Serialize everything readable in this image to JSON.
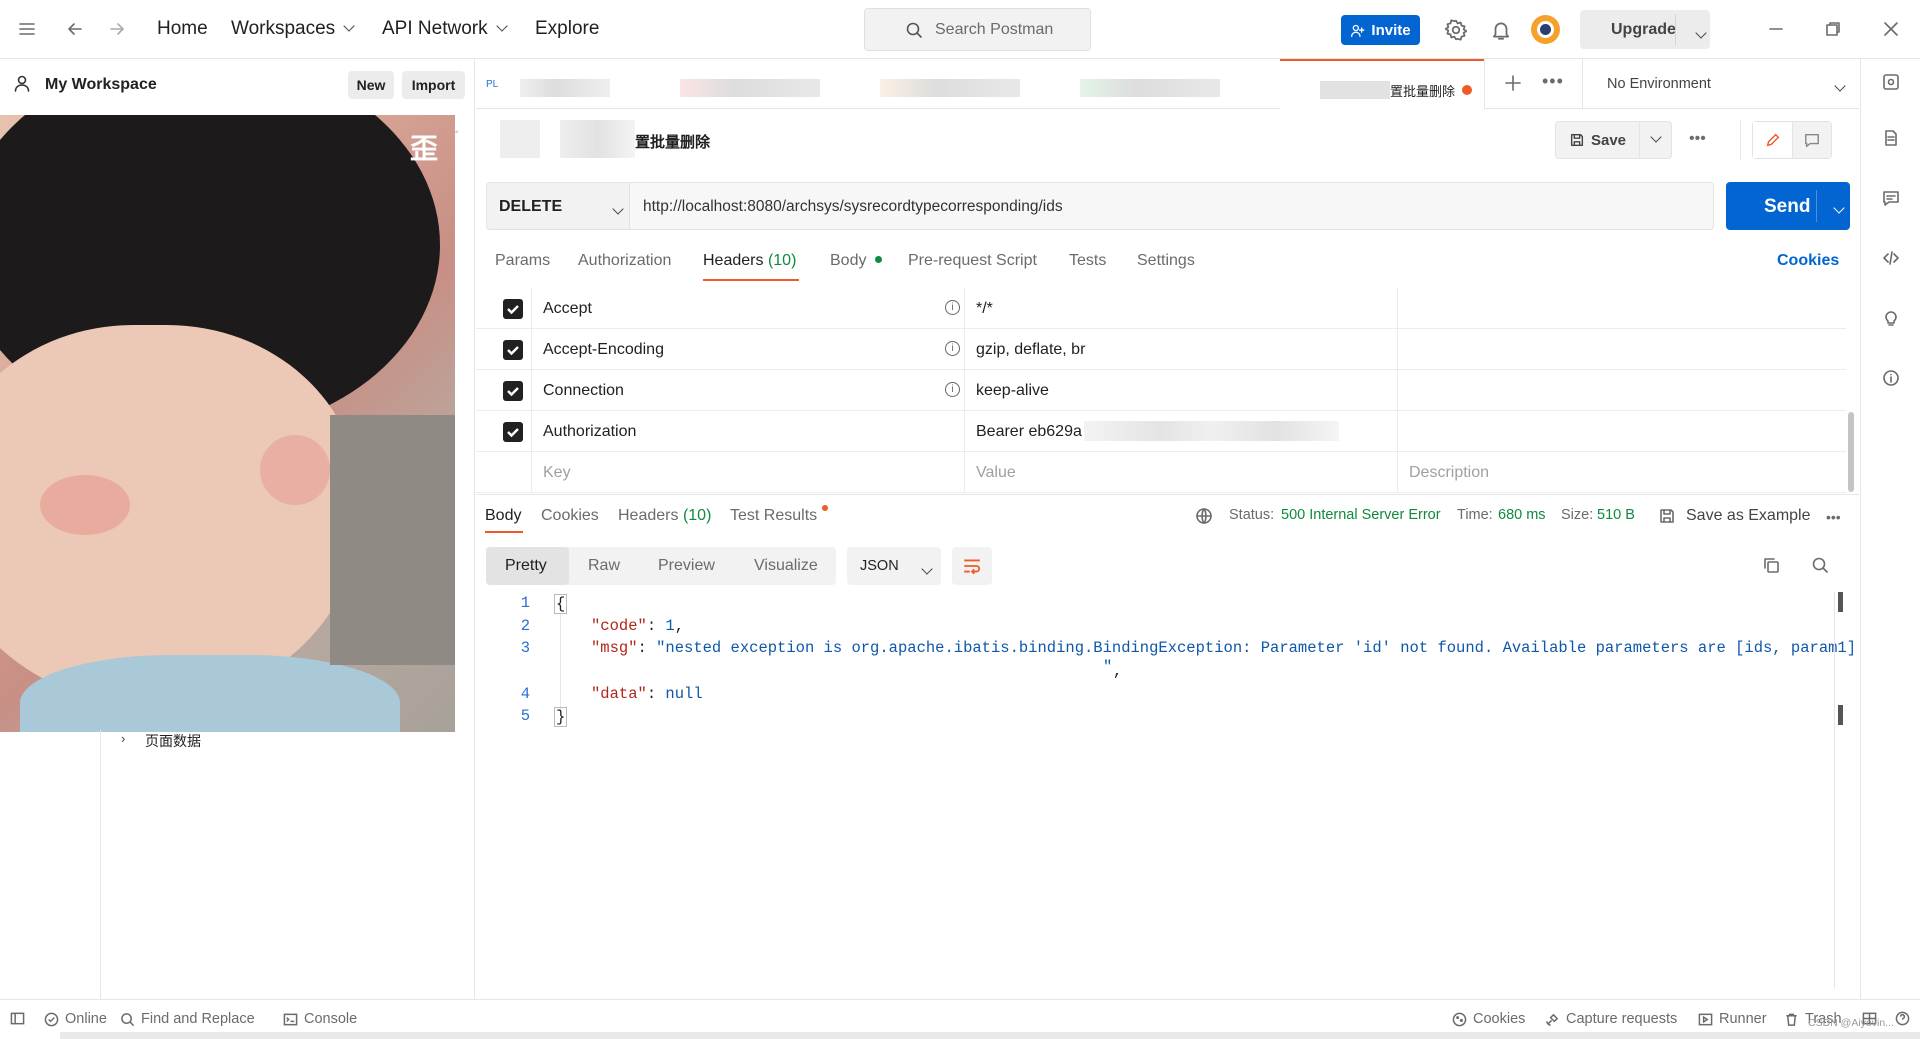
{
  "topbar": {
    "nav": [
      "Home",
      "Workspaces",
      "API Network",
      "Explore"
    ],
    "search_placeholder": "Search Postman",
    "invite": "Invite",
    "upgrade": "Upgrade"
  },
  "sidebar": {
    "workspace": "My Workspace",
    "new_label": "New",
    "import_label": "Import",
    "overlay_glyph": "歪",
    "tree_item": "页面数据"
  },
  "tabs": {
    "first_prefix": "PL",
    "active_tab_suffix": "置批量删除",
    "environment": "No Environment"
  },
  "request": {
    "name_suffix": "置批量删除",
    "save_label": "Save",
    "method": "DELETE",
    "url": "http://localhost:8080/archsys/sysrecordtypecorresponding/ids",
    "send_label": "Send",
    "tabs": [
      "Params",
      "Authorization",
      "Headers",
      "Body",
      "Pre-request Script",
      "Tests",
      "Settings"
    ],
    "headers_count": "(10)",
    "cookies_label": "Cookies"
  },
  "headers": {
    "rows": [
      {
        "key": "Accept",
        "value": "*/*"
      },
      {
        "key": "Accept-Encoding",
        "value": "gzip, deflate, br"
      },
      {
        "key": "Connection",
        "value": "keep-alive"
      },
      {
        "key": "Authorization",
        "value": "Bearer eb629a"
      }
    ],
    "placeholder_key": "Key",
    "placeholder_value": "Value",
    "placeholder_desc": "Description"
  },
  "response": {
    "tabs": [
      "Body",
      "Cookies",
      "Headers",
      "Test Results"
    ],
    "headers_count": "(10)",
    "status_label": "Status:",
    "status_value": "500 Internal Server Error",
    "time_label": "Time:",
    "time_value": "680 ms",
    "size_label": "Size:",
    "size_value": "510 B",
    "save_example": "Save as Example",
    "view_modes": [
      "Pretty",
      "Raw",
      "Preview",
      "Visualize"
    ],
    "format": "JSON",
    "lines": {
      "l1": "{",
      "code_key": "\"code\"",
      "code_val": "1",
      "msg_key": "\"msg\"",
      "msg_val": "\"nested exception is org.apache.ibatis.binding.BindingException: Parameter 'id' not found. Available parameters are [ids, param1]",
      "msg_end": "\"",
      "data_key": "\"data\"",
      "data_val": "null",
      "l5": "}"
    },
    "line_numbers": [
      "1",
      "2",
      "3",
      "4",
      "5"
    ]
  },
  "statusbar": {
    "online": "Online",
    "find": "Find and Replace",
    "console": "Console",
    "cookies": "Cookies",
    "capture": "Capture requests",
    "runner": "Runner",
    "trash": "Trash",
    "watermark": "CSDN @Aiyovin..."
  },
  "colors": {
    "brand_blue": "#0265d2",
    "status_green": "#0f8a3e",
    "unsaved_dot": "#f05a28"
  }
}
